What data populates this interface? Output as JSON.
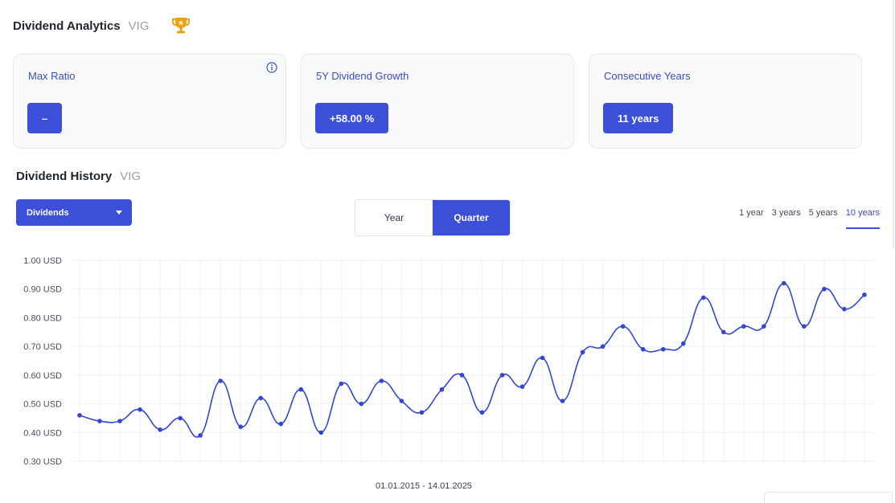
{
  "header": {
    "title": "Dividend Analytics",
    "ticker": "VIG",
    "trophy_icon": "trophy-icon"
  },
  "cards": [
    {
      "label": "Max Ratio",
      "value": "–",
      "has_info": true
    },
    {
      "label": "5Y Dividend Growth",
      "value": "+58.00 %"
    },
    {
      "label": "Consecutive Years",
      "value": "11 years"
    }
  ],
  "history": {
    "title": "Dividend History",
    "ticker": "VIG"
  },
  "controls": {
    "dropdown": "Dividends",
    "period_toggle": [
      {
        "label": "Year",
        "active": false
      },
      {
        "label": "Quarter",
        "active": true
      }
    ],
    "ranges": [
      {
        "label": "1 year",
        "active": false
      },
      {
        "label": "3 years",
        "active": false
      },
      {
        "label": "5 years",
        "active": false
      },
      {
        "label": "10 years",
        "active": true
      }
    ]
  },
  "colors": {
    "accent": "#3b4fd8",
    "line": "#3346d3",
    "grid": "#eef0f4"
  },
  "chart_data": {
    "type": "line",
    "xlabel": "01.01.2015 - 14.01.2025",
    "ylim": [
      0.3,
      1.0
    ],
    "y_ticks": [
      "1.00 USD",
      "0.90 USD",
      "0.80 USD",
      "0.70 USD",
      "0.60 USD",
      "0.50 USD",
      "0.40 USD",
      "0.30 USD"
    ],
    "grid": true,
    "series": [
      {
        "values": [
          0.46,
          0.44,
          0.44,
          0.48,
          0.41,
          0.45,
          0.39,
          0.58,
          0.42,
          0.52,
          0.43,
          0.55,
          0.4,
          0.57,
          0.5,
          0.58,
          0.51,
          0.47,
          0.55,
          0.6,
          0.47,
          0.6,
          0.56,
          0.66,
          0.51,
          0.68,
          0.7,
          0.77,
          0.69,
          0.69,
          0.71,
          0.87,
          0.75,
          0.77,
          0.77,
          0.92,
          0.77,
          0.9,
          0.83,
          0.88
        ]
      }
    ]
  }
}
